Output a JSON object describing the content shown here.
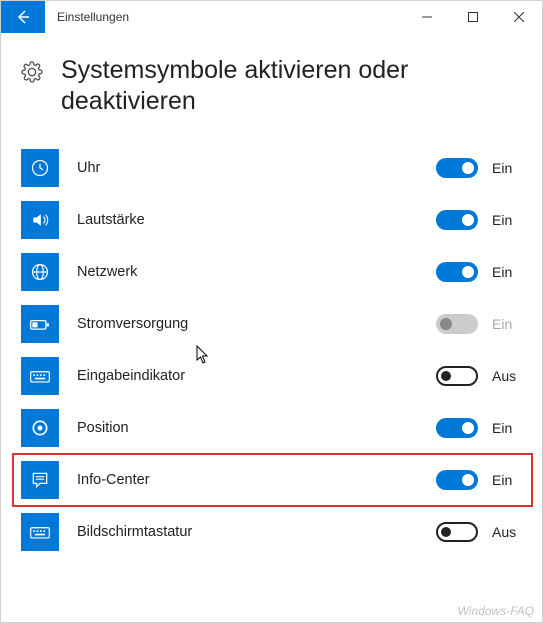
{
  "window": {
    "title": "Einstellungen"
  },
  "page": {
    "heading": "Systemsymbole aktivieren oder deaktivieren"
  },
  "state_labels": {
    "on": "Ein",
    "off": "Aus"
  },
  "items": [
    {
      "icon": "clock",
      "label": "Uhr",
      "state": "on",
      "highlighted": false
    },
    {
      "icon": "volume",
      "label": "Lautstärke",
      "state": "on",
      "highlighted": false
    },
    {
      "icon": "globe",
      "label": "Netzwerk",
      "state": "on",
      "highlighted": false
    },
    {
      "icon": "battery",
      "label": "Stromversorgung",
      "state": "disabled",
      "highlighted": false
    },
    {
      "icon": "keyboard",
      "label": "Eingabeindikator",
      "state": "off",
      "highlighted": false
    },
    {
      "icon": "target",
      "label": "Position",
      "state": "on",
      "highlighted": false
    },
    {
      "icon": "info",
      "label": "Info-Center",
      "state": "on",
      "highlighted": true
    },
    {
      "icon": "keyboard",
      "label": "Bildschirmtastatur",
      "state": "off",
      "highlighted": false
    }
  ],
  "watermark": "Windows-FAQ"
}
